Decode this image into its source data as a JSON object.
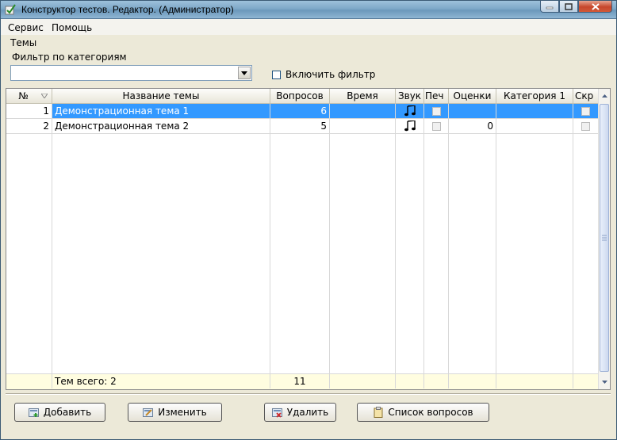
{
  "window": {
    "title": "Конструктор тестов. Редактор. (Администратор)"
  },
  "menu": {
    "items": [
      "Сервис",
      "Помощь"
    ]
  },
  "section_title": "Темы",
  "filter": {
    "label": "Фильтр по категориям",
    "selected": "",
    "checkbox_label": "Включить фильтр",
    "checked": false
  },
  "table": {
    "columns": [
      "№",
      "Название темы",
      "Вопросов",
      "Время",
      "Звук",
      "Печ",
      "Оценки",
      "Категория 1",
      "Скр"
    ],
    "rows": [
      {
        "num": "1",
        "name": "Демонстрационная тема 1",
        "questions": "6",
        "time": "",
        "sound": "music-note-icon",
        "print": false,
        "grades": "",
        "category": "",
        "hidden": false,
        "selected": true
      },
      {
        "num": "2",
        "name": "Демонстрационная тема 2",
        "questions": "5",
        "time": "",
        "sound": "music-note-icon",
        "print": false,
        "grades": "0",
        "category": "",
        "hidden": false,
        "selected": false
      }
    ],
    "footer": {
      "total_label": "Тем всего: 2",
      "total_questions": "11"
    }
  },
  "buttons": {
    "add": "Добавить",
    "edit": "Изменить",
    "delete": "Удалить",
    "questions": "Список вопросов"
  },
  "colors": {
    "selection": "#3399ff",
    "footer_bg": "#fffde0"
  }
}
